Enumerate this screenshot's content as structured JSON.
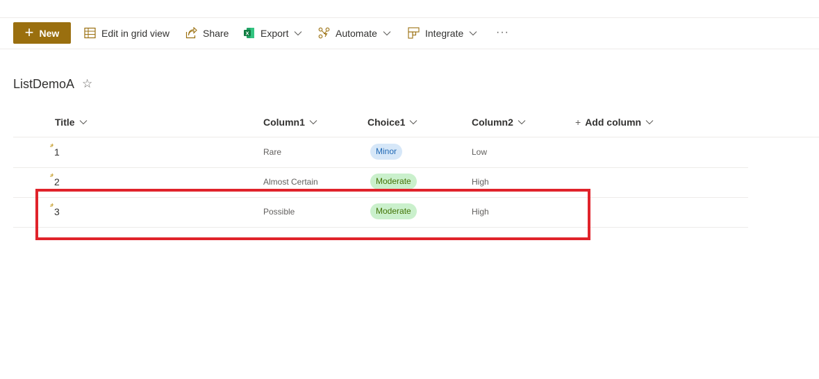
{
  "toolbar": {
    "new_label": "New",
    "edit_grid_label": "Edit in grid view",
    "share_label": "Share",
    "export_label": "Export",
    "automate_label": "Automate",
    "integrate_label": "Integrate",
    "more_label": "···"
  },
  "list": {
    "title": "ListDemoA",
    "favorite_icon": "star-icon"
  },
  "columns": {
    "title": "Title",
    "column1": "Column1",
    "choice1": "Choice1",
    "column2": "Column2",
    "add_column": "Add column"
  },
  "rows": [
    {
      "title": "1",
      "column1": "Rare",
      "choice1": "Minor",
      "column2": "Low"
    },
    {
      "title": "2",
      "column1": "Almost Certain",
      "choice1": "Moderate",
      "column2": "High"
    },
    {
      "title": "3",
      "column1": "Possible",
      "choice1": "Moderate",
      "column2": "High"
    }
  ],
  "colors": {
    "accent": "#9a6f0f",
    "minor_pill_bg": "#d6e7f8",
    "moderate_pill_bg": "#caf0cc",
    "highlight_border": "#e0232b"
  }
}
